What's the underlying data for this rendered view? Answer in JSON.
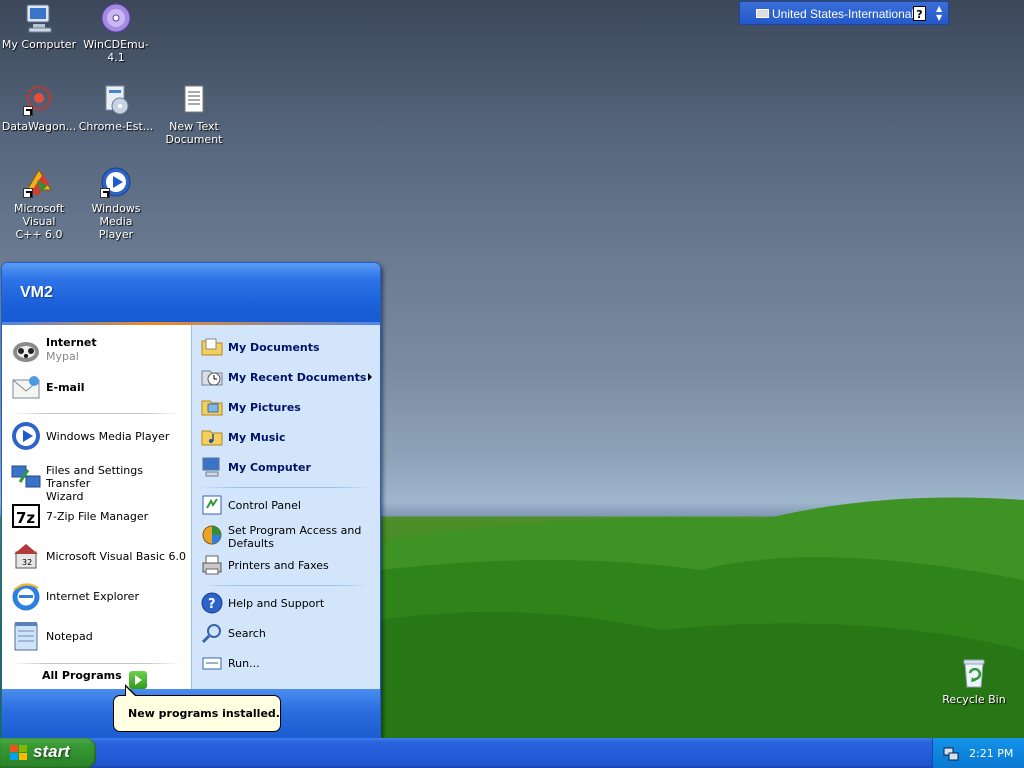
{
  "desktop": {
    "icons": [
      {
        "label": "My Computer",
        "icon": "my-computer-icon"
      },
      {
        "label": "WinCDEmu-4.1",
        "icon": "wincdemu-icon"
      },
      {
        "label": "DataWagon...",
        "icon": "datawagon-icon"
      },
      {
        "label": "Chrome-Est...",
        "icon": "installer-icon"
      },
      {
        "label": "New Text\nDocument",
        "icon": "text-document-icon"
      },
      {
        "label": "Microsoft Visual\nC++ 6.0",
        "icon": "visual-cpp-icon"
      },
      {
        "label": "Windows Media\nPlayer",
        "icon": "media-player-icon"
      },
      {
        "label": "Recycle Bin",
        "icon": "recycle-bin-icon"
      }
    ]
  },
  "language_bar": {
    "language": "United States-International",
    "help": "?"
  },
  "start_menu": {
    "user": "VM2",
    "pinned": [
      {
        "title": "Internet",
        "subtitle": "Mypal",
        "icon": "mypal-browser-icon"
      },
      {
        "title": "E-mail",
        "subtitle": "",
        "icon": "email-icon"
      }
    ],
    "recent": [
      {
        "label": "Windows Media Player",
        "icon": "media-player-icon"
      },
      {
        "label": "Files and Settings Transfer\nWizard",
        "icon": "transfer-wizard-icon"
      },
      {
        "label": "7-Zip File Manager",
        "icon": "7zip-icon"
      },
      {
        "label": "Microsoft Visual Basic 6.0",
        "icon": "visual-basic-icon"
      },
      {
        "label": "Internet Explorer",
        "icon": "internet-explorer-icon"
      },
      {
        "label": "Notepad",
        "icon": "notepad-icon"
      }
    ],
    "all_programs": "All Programs",
    "places": [
      {
        "label": "My Documents",
        "icon": "folder-documents-icon"
      },
      {
        "label": "My Recent Documents",
        "icon": "recent-documents-icon"
      },
      {
        "label": "My Pictures",
        "icon": "folder-pictures-icon"
      },
      {
        "label": "My Music",
        "icon": "folder-music-icon"
      },
      {
        "label": "My Computer",
        "icon": "my-computer-icon"
      }
    ],
    "settings": [
      {
        "label": "Control Panel",
        "icon": "control-panel-icon"
      },
      {
        "label": "Set Program Access and\nDefaults",
        "icon": "program-access-icon"
      },
      {
        "label": "Printers and Faxes",
        "icon": "printer-icon"
      }
    ],
    "tools": [
      {
        "label": "Help and Support",
        "icon": "help-icon"
      },
      {
        "label": "Search",
        "icon": "search-icon"
      },
      {
        "label": "Run...",
        "icon": "run-icon"
      }
    ]
  },
  "balloon": {
    "text": "New programs installed."
  },
  "taskbar": {
    "start_label": "start",
    "clock": "2:21 PM"
  },
  "colors": {
    "taskbar_blue": "#245edb",
    "start_green": "#379b35",
    "menu_header_blue": "#1a5fd9",
    "places_bg": "#d3e5fa",
    "balloon_bg": "#ffffe1"
  }
}
